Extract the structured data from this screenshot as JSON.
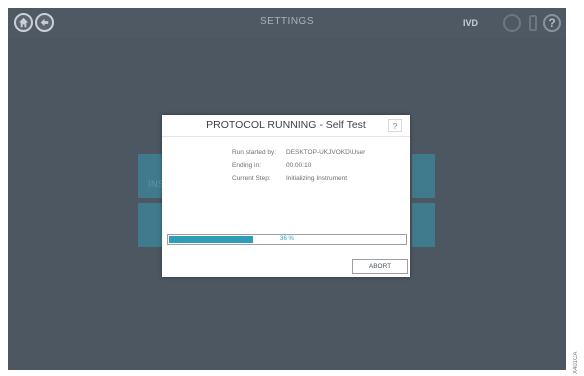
{
  "topbar": {
    "title": "SETTINGS",
    "ivd_label": "IVD",
    "help_glyph": "?",
    "home_icon": "home-icon",
    "back_icon": "back-arrow-icon",
    "status_icon": "status-ring-icon",
    "device_icon": "device-icon",
    "help_icon": "help-icon"
  },
  "background": {
    "tile_label": "INS"
  },
  "dialog": {
    "title": "PROTOCOL RUNNING - Self Test",
    "help_glyph": "?",
    "info": [
      {
        "label": "Run started by:",
        "value": "DESKTOP-UKJVOKD\\User"
      },
      {
        "label": "Ending in:",
        "value": "00:00:10"
      },
      {
        "label": "Current Step:",
        "value": "Initializing Instrument"
      }
    ],
    "progress": {
      "percent": 36,
      "label": "36 %"
    },
    "abort_label": "ABORT"
  },
  "figure_id": "X401CA",
  "colors": {
    "app_background": "#4c5761",
    "accent": "#2f9db8",
    "tile": "#3f7f92"
  }
}
